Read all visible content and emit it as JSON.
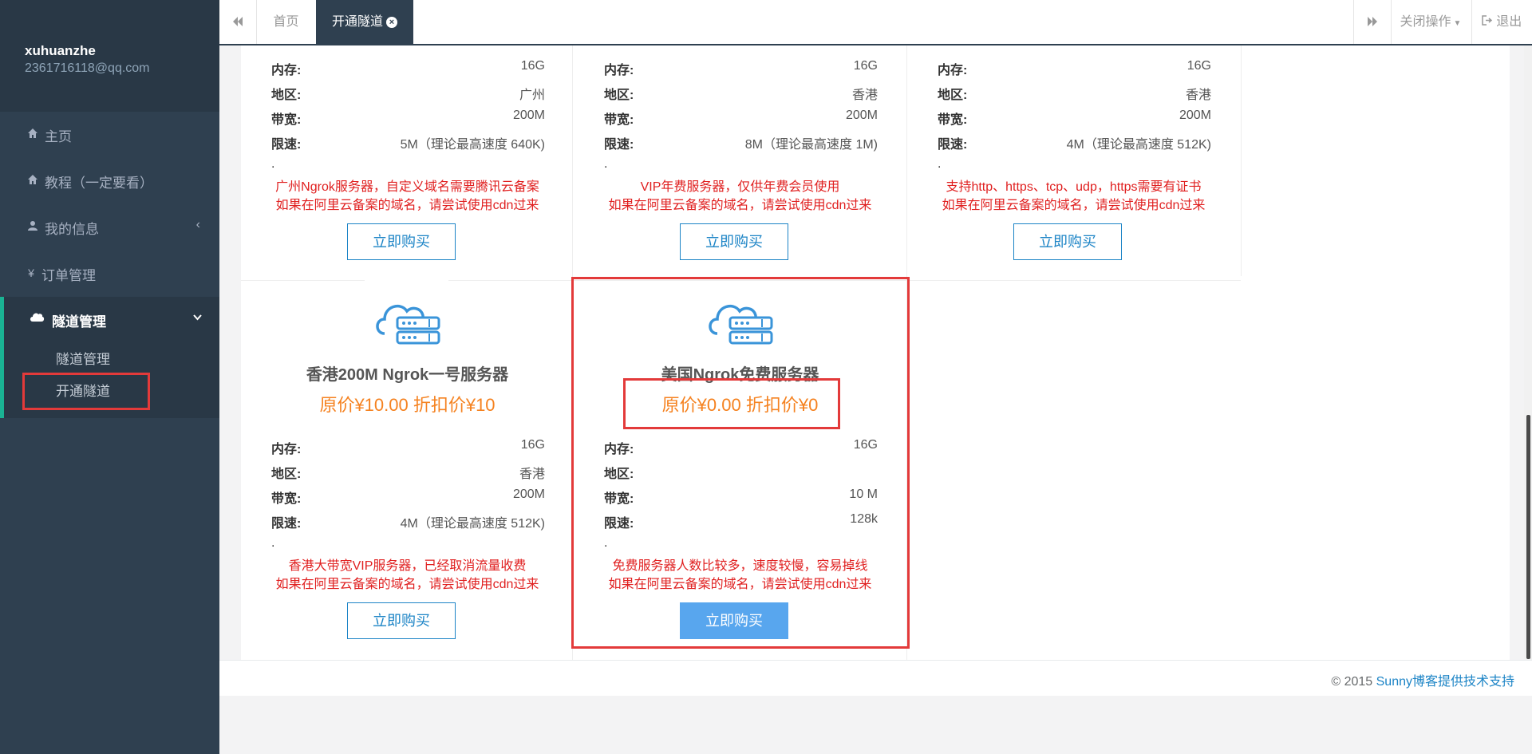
{
  "profile": {
    "username": "xuhuanzhe",
    "email": "2361716118@qq.com"
  },
  "sidebar": {
    "items": [
      {
        "icon": "home-icon",
        "label": "主页"
      },
      {
        "icon": "home-icon",
        "label": "教程（一定要看）"
      },
      {
        "icon": "user-icon",
        "label": "我的信息"
      },
      {
        "icon": "yen-icon",
        "label": "订单管理"
      }
    ],
    "active": {
      "icon": "cloud-icon",
      "label": "隧道管理",
      "subitems": [
        "隧道管理",
        "开通隧道"
      ]
    }
  },
  "topbar": {
    "tabs": [
      {
        "label": "首页"
      },
      {
        "label": "开通隧道"
      }
    ],
    "close_ops": "关闭操作",
    "logout": "退出"
  },
  "labels": {
    "memory": "内存:",
    "region": "地区:",
    "bandwidth": "带宽:",
    "limit": "限速:",
    "dot": ".",
    "buy": "立即购买"
  },
  "cards": [
    {
      "memory": "16G",
      "region": "广州",
      "bandwidth": "200M",
      "limit": "5M（理论最高速度 640K)",
      "desc1": "广州Ngrok服务器，自定义域名需要腾讯云备案",
      "desc2": "如果在阿里云备案的域名，请尝试使用cdn过来"
    },
    {
      "memory": "16G",
      "region": "香港",
      "bandwidth": "200M",
      "limit": "8M（理论最高速度 1M)",
      "desc1": "VIP年费服务器，仅供年费会员使用",
      "desc2": "如果在阿里云备案的域名，请尝试使用cdn过来"
    },
    {
      "memory": "16G",
      "region": "香港",
      "bandwidth": "200M",
      "limit": "4M（理论最高速度 512K)",
      "desc1": "支持http、https、tcp、udp，https需要有证书",
      "desc2": "如果在阿里云备案的域名，请尝试使用cdn过来"
    },
    {
      "title": "香港200M Ngrok一号服务器",
      "price": "原价¥10.00   折扣价¥10",
      "memory": "16G",
      "region": "香港",
      "bandwidth": "200M",
      "limit": "4M（理论最高速度 512K)",
      "desc1": "香港大带宽VIP服务器，已经取消流量收费",
      "desc2": "如果在阿里云备案的域名，请尝试使用cdn过来"
    },
    {
      "title": "美国Ngrok免费服务器",
      "price": "原价¥0.00   折扣价¥0",
      "memory": "16G",
      "region": "",
      "bandwidth": "10 M",
      "limit": "128k",
      "desc1": "免费服务器人数比较多，速度较慢，容易掉线",
      "desc2": "如果在阿里云备案的域名，请尝试使用cdn过来"
    }
  ],
  "footer": {
    "prefix": "© 2015 ",
    "link": "Sunny博客提供技术支持"
  },
  "colors": {
    "sidebar": "#2f4050",
    "accent": "#1ab394",
    "price": "#f58220",
    "desc": "#e02020",
    "link": "#1c84c6",
    "highlight": "#e33a3a"
  }
}
